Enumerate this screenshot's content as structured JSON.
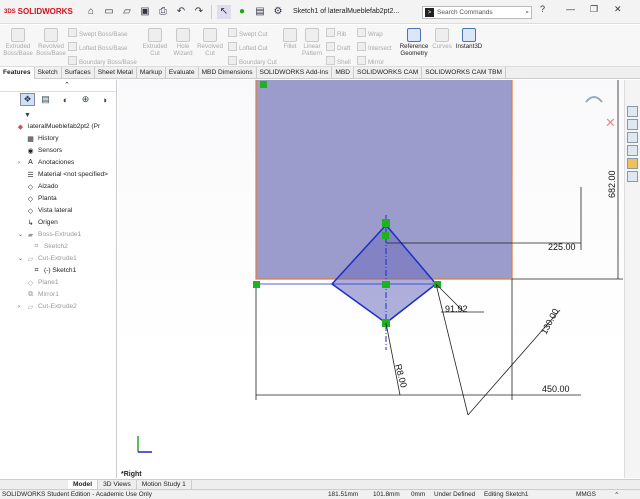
{
  "app": {
    "brand": "SOLIDWORKS",
    "ds_mark": "3DS"
  },
  "titlebar": {
    "doc_title": "Sketch1 of lateralMueblefab2pt2...",
    "search_placeholder": "Search Commands"
  },
  "ribbon": {
    "big_buttons": [
      {
        "label": "Extruded Boss/Base"
      },
      {
        "label": "Revolved Boss/Base"
      },
      {
        "label": "Extruded Cut"
      },
      {
        "label": "Hole Wizard"
      },
      {
        "label": "Revolved Cut"
      },
      {
        "label": "Fillet"
      },
      {
        "label": "Linear Pattern"
      },
      {
        "label": "Reference Geometry"
      },
      {
        "label": "Curves"
      },
      {
        "label": "Instant3D"
      }
    ],
    "small_buttons": [
      {
        "label": "Swept Boss/Base"
      },
      {
        "label": "Lofted Boss/Base"
      },
      {
        "label": "Boundary Boss/Base"
      },
      {
        "label": "Swept Cut"
      },
      {
        "label": "Lofted Cut"
      },
      {
        "label": "Boundary Cut"
      },
      {
        "label": "Rib"
      },
      {
        "label": "Draft"
      },
      {
        "label": "Shell"
      },
      {
        "label": "Wrap"
      },
      {
        "label": "Intersect"
      },
      {
        "label": "Mirror"
      }
    ]
  },
  "tabs": [
    "Features",
    "Sketch",
    "Surfaces",
    "Sheet Metal",
    "Markup",
    "Evaluate",
    "MBD Dimensions",
    "SOLIDWORKS Add-Ins",
    "MBD",
    "SOLIDWORKS CAM",
    "SOLIDWORKS CAM TBM"
  ],
  "tree": {
    "root": "lateralMueblefab2pt2 (Pr",
    "items": [
      {
        "label": "History"
      },
      {
        "label": "Sensors"
      },
      {
        "label": "Anotaciones"
      },
      {
        "label": "Material <not specified>"
      },
      {
        "label": "Alzado"
      },
      {
        "label": "Planta"
      },
      {
        "label": "Vista lateral"
      },
      {
        "label": "Origen"
      },
      {
        "label": "Boss-Extrude1"
      },
      {
        "label": "Sketch2"
      },
      {
        "label": "Cut-Extrude1"
      },
      {
        "label": "(-) Sketch1"
      },
      {
        "label": "Plane1"
      },
      {
        "label": "Mirror1"
      },
      {
        "label": "Cut-Extrude2"
      }
    ]
  },
  "dimensions": {
    "d_225": "225.00",
    "d_682": "682.00",
    "d_9192": "91.92",
    "d_130": "130.00",
    "d_r8": "R8.00",
    "d_450": "450.00"
  },
  "view_label": "*Right",
  "bottom_tabs": [
    "Model",
    "3D Views",
    "Motion Study 1"
  ],
  "status": {
    "edition": "SOLIDWORKS Student Edition - Academic Use Only",
    "x": "181.51mm",
    "y": "101.8mm",
    "z": "0mm",
    "state": "Under Defined",
    "editing": "Editing Sketch1",
    "units": "MMGS"
  },
  "colors": {
    "brand_red": "#d0121b",
    "face": "#9b9ccc",
    "sketch_blue": "#1c2fc9",
    "edge_orange": "#e07b39",
    "relation_green": "#1fb21f"
  }
}
